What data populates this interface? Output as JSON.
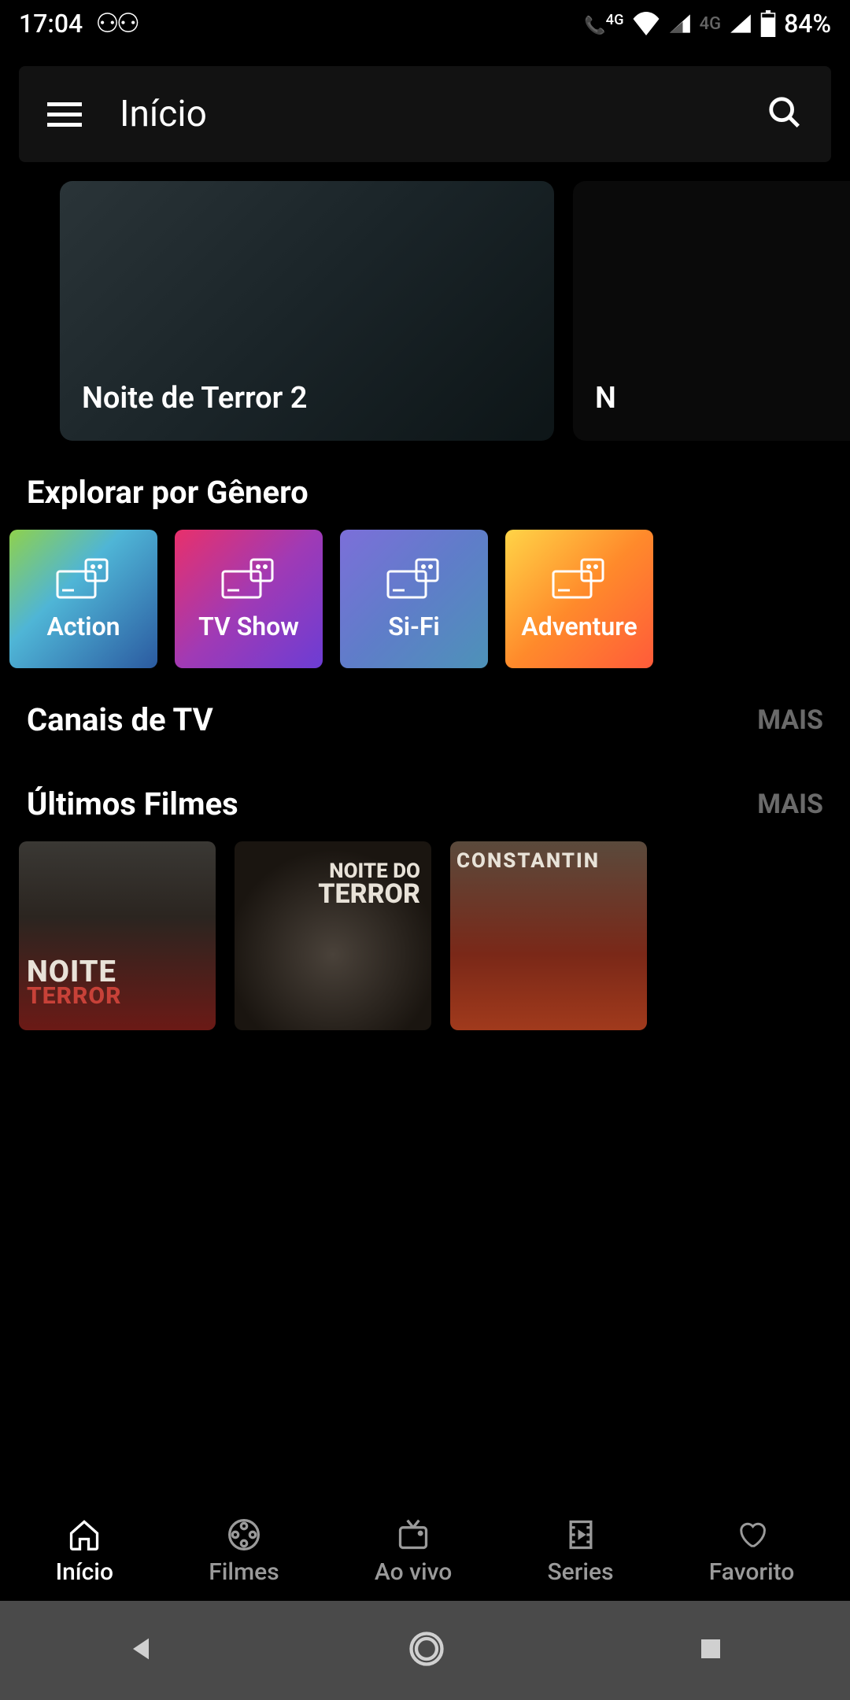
{
  "status": {
    "time": "17:04",
    "battery": "84%",
    "network_label": "4G"
  },
  "header": {
    "title": "Início"
  },
  "featured": {
    "items": [
      {
        "title": "Noite de Terror 2"
      },
      {
        "title": "N"
      }
    ]
  },
  "genres": {
    "section_title": "Explorar por Gênero",
    "items": [
      {
        "label": "Action"
      },
      {
        "label": "TV Show"
      },
      {
        "label": "Si-Fi"
      },
      {
        "label": "Adventure"
      }
    ]
  },
  "channels": {
    "title": "Canais de TV",
    "more": "MAIS"
  },
  "latest": {
    "title": "Últimos Filmes",
    "more": "MAIS",
    "posters": [
      {
        "line1": "NOITE",
        "line2": "TERROR"
      },
      {
        "line1": "NOITE DO",
        "line2": "TERROR"
      },
      {
        "line1": "CONSTANTIN"
      }
    ]
  },
  "nav": {
    "items": [
      {
        "label": "Início"
      },
      {
        "label": "Filmes"
      },
      {
        "label": "Ao vivo"
      },
      {
        "label": "Series"
      },
      {
        "label": "Favorito"
      }
    ]
  }
}
